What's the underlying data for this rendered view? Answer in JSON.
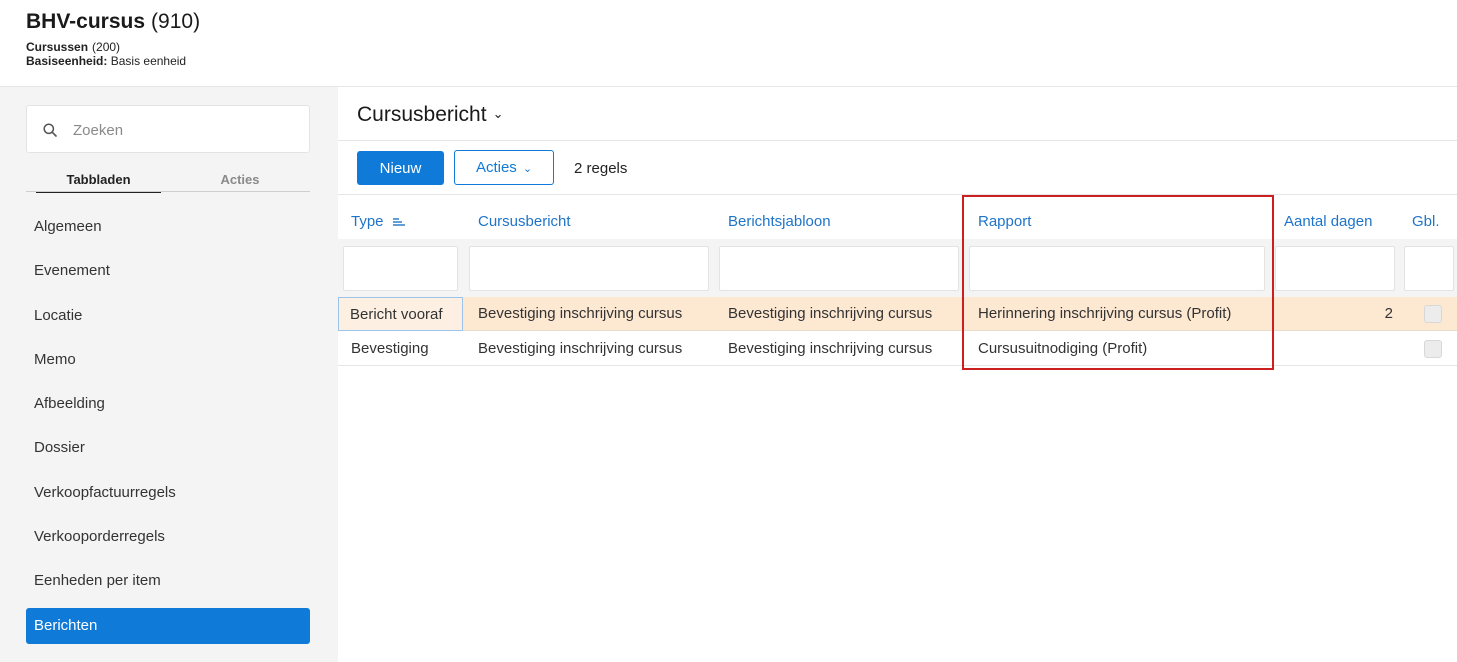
{
  "header": {
    "title": "BHV-cursus",
    "title_count": "(910)",
    "subtitle_label": "Cursussen",
    "subtitle_count": "(200)",
    "unit_label": "Basiseenheid:",
    "unit_value": "Basis eenheid"
  },
  "sidebar": {
    "search_placeholder": "Zoeken",
    "tabs": {
      "tabbladen": "Tabbladen",
      "acties": "Acties"
    },
    "items": [
      {
        "label": "Algemeen"
      },
      {
        "label": "Evenement"
      },
      {
        "label": "Locatie"
      },
      {
        "label": "Memo"
      },
      {
        "label": "Afbeelding"
      },
      {
        "label": "Dossier"
      },
      {
        "label": "Verkoopfactuurregels"
      },
      {
        "label": "Verkooporderregels"
      },
      {
        "label": "Eenheden per item"
      },
      {
        "label": "Berichten"
      }
    ],
    "active_item": "Berichten"
  },
  "main": {
    "title": "Cursusbericht",
    "new_button": "Nieuw",
    "actions_button": "Acties",
    "row_count": "2 regels",
    "columns": {
      "type": "Type",
      "cursusbericht": "Cursusbericht",
      "berichtsjabloon": "Berichtsjabloon",
      "rapport": "Rapport",
      "aantal_dagen": "Aantal dagen",
      "gbl": "Gbl."
    },
    "rows": [
      {
        "type": "Bericht vooraf",
        "cursusbericht": "Bevestiging inschrijving cursus",
        "berichtsjabloon": "Bevestiging inschrijving cursus",
        "rapport": "Herinnering inschrijving cursus (Profit)",
        "aantal_dagen": "2",
        "gbl": false
      },
      {
        "type": "Bevestiging",
        "cursusbericht": "Bevestiging inschrijving cursus",
        "berichtsjabloon": "Bevestiging inschrijving cursus",
        "rapport": "Cursusuitnodiging (Profit)",
        "aantal_dagen": "",
        "gbl": false
      }
    ]
  },
  "colors": {
    "accent": "#0f7ad8",
    "link": "#1f74c8",
    "selected_row": "#fde8d2",
    "highlight_box": "#cc1f1f",
    "sidebar_bg": "#f4f4f4"
  }
}
